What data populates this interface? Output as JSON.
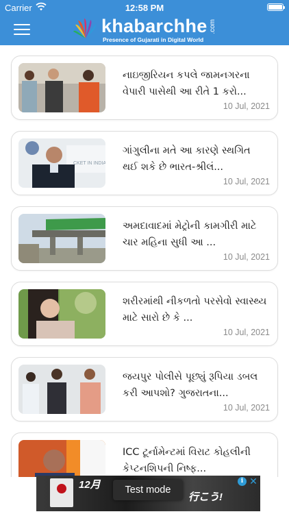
{
  "status_bar": {
    "carrier": "Carrier",
    "time": "12:58 PM"
  },
  "header": {
    "logo_text": "khabarchhe",
    "logo_suffix": ".com",
    "tagline": "Presence of Gujarati in Digital World",
    "menu_icon": "hamburger-menu-icon"
  },
  "articles": [
    {
      "title": "નાઇજીરિયન કપલે જામનગરના વેપારી પાસેથી આ રીતે 1 કરો...",
      "date": "10 Jul, 2021",
      "thumb": "three-men-photo"
    },
    {
      "title": "ગાંગુલીના મતે આ કારણે સ્થગિત થઈ શકે છે ભારત-શ્રીલં...",
      "date": "10 Jul, 2021",
      "thumb": "ganguly-photo"
    },
    {
      "title": "અમદાવાદમાં મેટ્રોની કામગીરી માટે ચાર મહિના સુધી આ ...",
      "date": "10 Jul, 2021",
      "thumb": "metro-construction-photo"
    },
    {
      "title": "શરીરમાંથી નીકળતો પરસેવો સ્વાસ્થ્ય માટે સારો છે કે ...",
      "date": "10 Jul, 2021",
      "thumb": "sweating-woman-photo"
    },
    {
      "title": "જયપુર પોલીસે પૂછ્યું રૂપિયા ડબલ કરી આપશો? ગુજરાતના...",
      "date": "10 Jul, 2021",
      "thumb": "three-suspects-photo"
    },
    {
      "title": "ICC ટૂર્નામેન્ટમાં વિરાટ કોહલીની કેપ્ટનશિપની નિષ્ફ...",
      "date": "",
      "thumb": "kohli-photo"
    }
  ],
  "ad": {
    "text_1": "12月",
    "text_2": "行こう!",
    "mode_label": "Test mode",
    "info_label": "i",
    "close_label": "✕"
  },
  "colors": {
    "header_blue": "#3c8fd8",
    "date_gray": "#8a8a8a"
  }
}
